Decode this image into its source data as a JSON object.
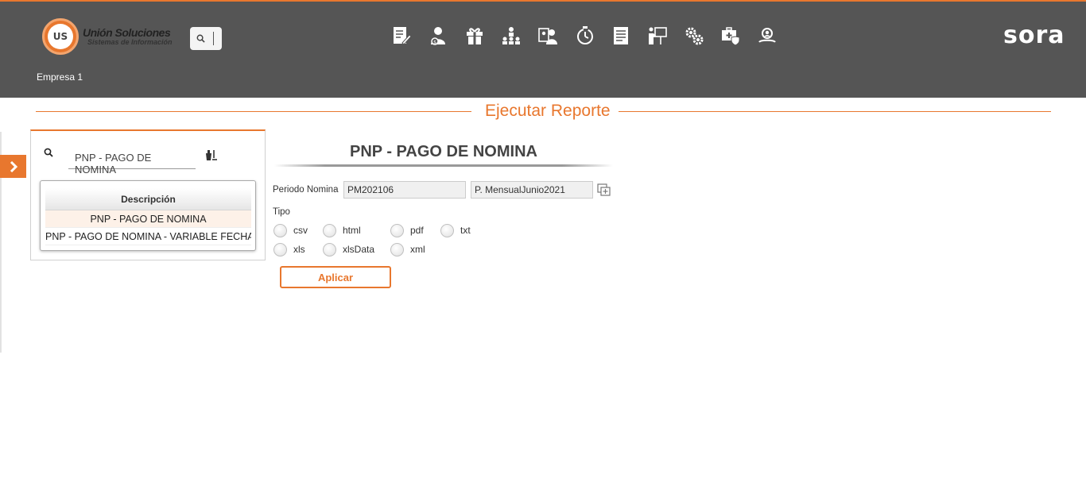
{
  "header": {
    "logo_title": "Unión Soluciones",
    "logo_subtitle": "Sistemas de Información",
    "logo_mark": "US",
    "brand": "sora",
    "company": "Empresa 1",
    "accent_color": "#e8772e",
    "bar_color": "#555555",
    "nav_icons": [
      "document-edit-icon",
      "user-money-icon",
      "gift-icon",
      "hierarchy-icon",
      "id-card-user-icon",
      "timer-icon",
      "report-sheet-icon",
      "presentation-icon",
      "gears-icon",
      "medical-kit-icon",
      "user-search-icon"
    ]
  },
  "page": {
    "title": "Ejecutar Reporte"
  },
  "left_panel": {
    "search_value": "PNP - PAGO DE NOMINA",
    "grid_header": "Descripción",
    "rows": [
      "PNP - PAGO DE NOMINA",
      "PNP - PAGO DE NOMINA - VARIABLE FECHA"
    ],
    "selected_row": 0
  },
  "report": {
    "title": "PNP - PAGO DE NOMINA",
    "periodo_label": "Periodo Nomina",
    "periodo_code": "PM202106",
    "periodo_desc": "P. MensualJunio2021",
    "tipo_label": "Tipo",
    "tipos": [
      "csv",
      "html",
      "pdf",
      "txt",
      "xls",
      "xlsData",
      "xml"
    ],
    "apply_label": "Aplicar"
  }
}
